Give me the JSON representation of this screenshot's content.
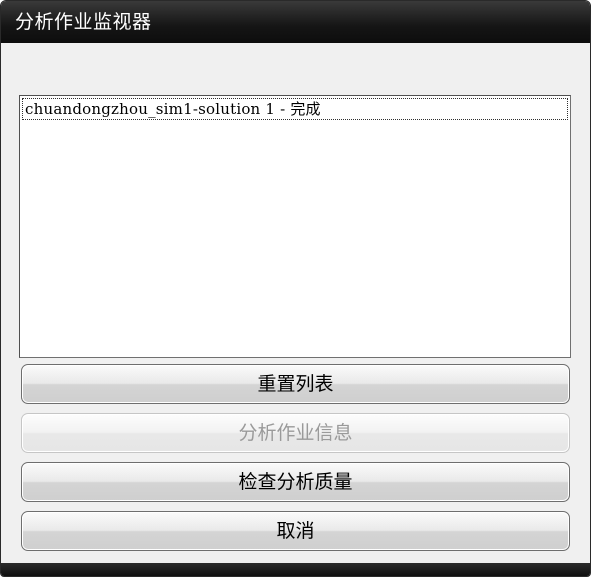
{
  "window": {
    "title": "分析作业监视器"
  },
  "job_list": {
    "items": [
      "chuandongzhou_sim1-solution 1 - 完成"
    ]
  },
  "buttons": {
    "reset_list": "重置列表",
    "job_info": "分析作业信息",
    "check_quality": "检查分析质量",
    "cancel": "取消"
  }
}
